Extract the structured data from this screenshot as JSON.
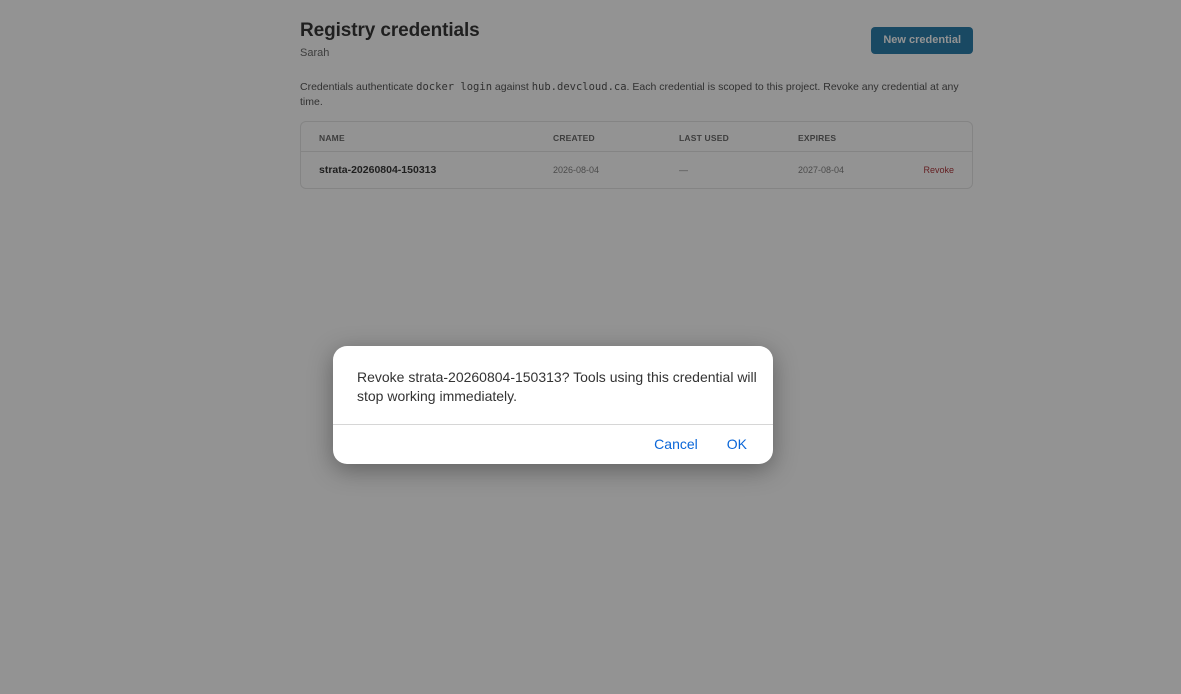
{
  "header": {
    "title": "Registry credentials",
    "subtitle": "Sarah",
    "new_credential_label": "New credential"
  },
  "description": {
    "part1": "Credentials authenticate ",
    "code1": "docker login",
    "part2": " against ",
    "code2": "hub.devcloud.ca",
    "part3": ". Each credential is scoped to this project. Revoke any credential at any time."
  },
  "table": {
    "columns": {
      "name": "NAME",
      "created": "CREATED",
      "last_used": "LAST USED",
      "expires": "EXPIRES"
    },
    "rows": [
      {
        "name": "strata-20260804-150313",
        "created": "2026-08-04",
        "last_used": "—",
        "expires": "2027-08-04",
        "action": "Revoke"
      }
    ]
  },
  "dialog": {
    "message": "Revoke strata-20260804-150313? Tools using this credential will stop working immediately.",
    "cancel_label": "Cancel",
    "ok_label": "OK"
  },
  "colors": {
    "primary_button": "#0b6a9e",
    "danger_link": "#a2191f",
    "dialog_link": "#0a66d8",
    "overlay": "rgba(40,40,40,0.5)"
  }
}
